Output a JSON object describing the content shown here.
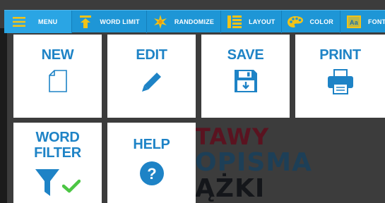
{
  "background": {
    "lines": [
      "TAWY",
      "OPISMA",
      "ĄŻKI"
    ]
  },
  "toolbar": {
    "items": [
      {
        "label": "MENU",
        "icon": "hamburger-icon"
      },
      {
        "label": "WORD LIMIT",
        "icon": "pin-icon"
      },
      {
        "label": "RANDOMIZE",
        "icon": "sparkle-icon"
      },
      {
        "label": "LAYOUT",
        "icon": "layout-list-icon"
      },
      {
        "label": "COLOR",
        "icon": "palette-icon"
      },
      {
        "label": "FONT",
        "icon": "font-icon"
      }
    ],
    "font_icon_text": "Aa"
  },
  "tiles": {
    "new": {
      "label": "NEW",
      "icon": "new-document-icon"
    },
    "edit": {
      "label": "EDIT",
      "icon": "pencil-icon"
    },
    "save": {
      "label": "SAVE",
      "icon": "floppy-disk-icon"
    },
    "print": {
      "label": "PRINT",
      "icon": "printer-icon"
    },
    "word_filter": {
      "label_line1": "WORD",
      "label_line2": "FILTER",
      "icon": "funnel-icon",
      "status_icon": "checkmark-icon"
    },
    "help": {
      "label": "HELP",
      "icon": "help-icon",
      "icon_text": "?"
    }
  },
  "colors": {
    "toolbar": "#1e96d6",
    "accent": "#1e83c6",
    "check": "#4cc644",
    "icon_yellow": "#f2c318"
  }
}
